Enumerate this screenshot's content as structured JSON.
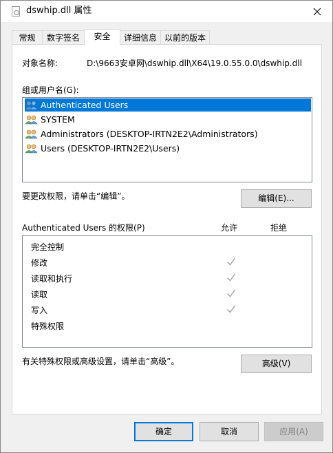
{
  "window": {
    "title": "dswhip.dll 属性"
  },
  "tabs": [
    {
      "label": "常规"
    },
    {
      "label": "数字签名"
    },
    {
      "label": "安全"
    },
    {
      "label": "详细信息"
    },
    {
      "label": "以前的版本"
    }
  ],
  "security": {
    "object_label": "对象名称:",
    "object_value": "D:\\9663安卓网\\dswhip.dll\\X64\\19.0.55.0.0\\dswhip.dll",
    "group_label": "组或用户名(G):",
    "users": [
      {
        "name": "Authenticated Users",
        "selected": true
      },
      {
        "name": "SYSTEM"
      },
      {
        "name": "Administrators (DESKTOP-IRTN2E2\\Administrators)"
      },
      {
        "name": "Users (DESKTOP-IRTN2E2\\Users)"
      }
    ],
    "edit_hint": "要更改权限，请单击“编辑”。",
    "edit_button": "编辑(E)...",
    "perm_title": "Authenticated Users 的权限(P)",
    "allow_header": "允许",
    "deny_header": "拒绝",
    "permissions": [
      {
        "name": "完全控制",
        "allow": false
      },
      {
        "name": "修改",
        "allow": true
      },
      {
        "name": "读取和执行",
        "allow": true
      },
      {
        "name": "读取",
        "allow": true
      },
      {
        "name": "写入",
        "allow": true
      },
      {
        "name": "特殊权限",
        "allow": false
      }
    ],
    "advanced_hint": "有关特殊权限或高级设置，请单击“高级”。",
    "advanced_button": "高级(V)"
  },
  "footer": {
    "ok": "确定",
    "cancel": "取消",
    "apply": "应用(A)"
  },
  "colors": {
    "accent": "#0078d7",
    "check": "#a0a0a0"
  }
}
